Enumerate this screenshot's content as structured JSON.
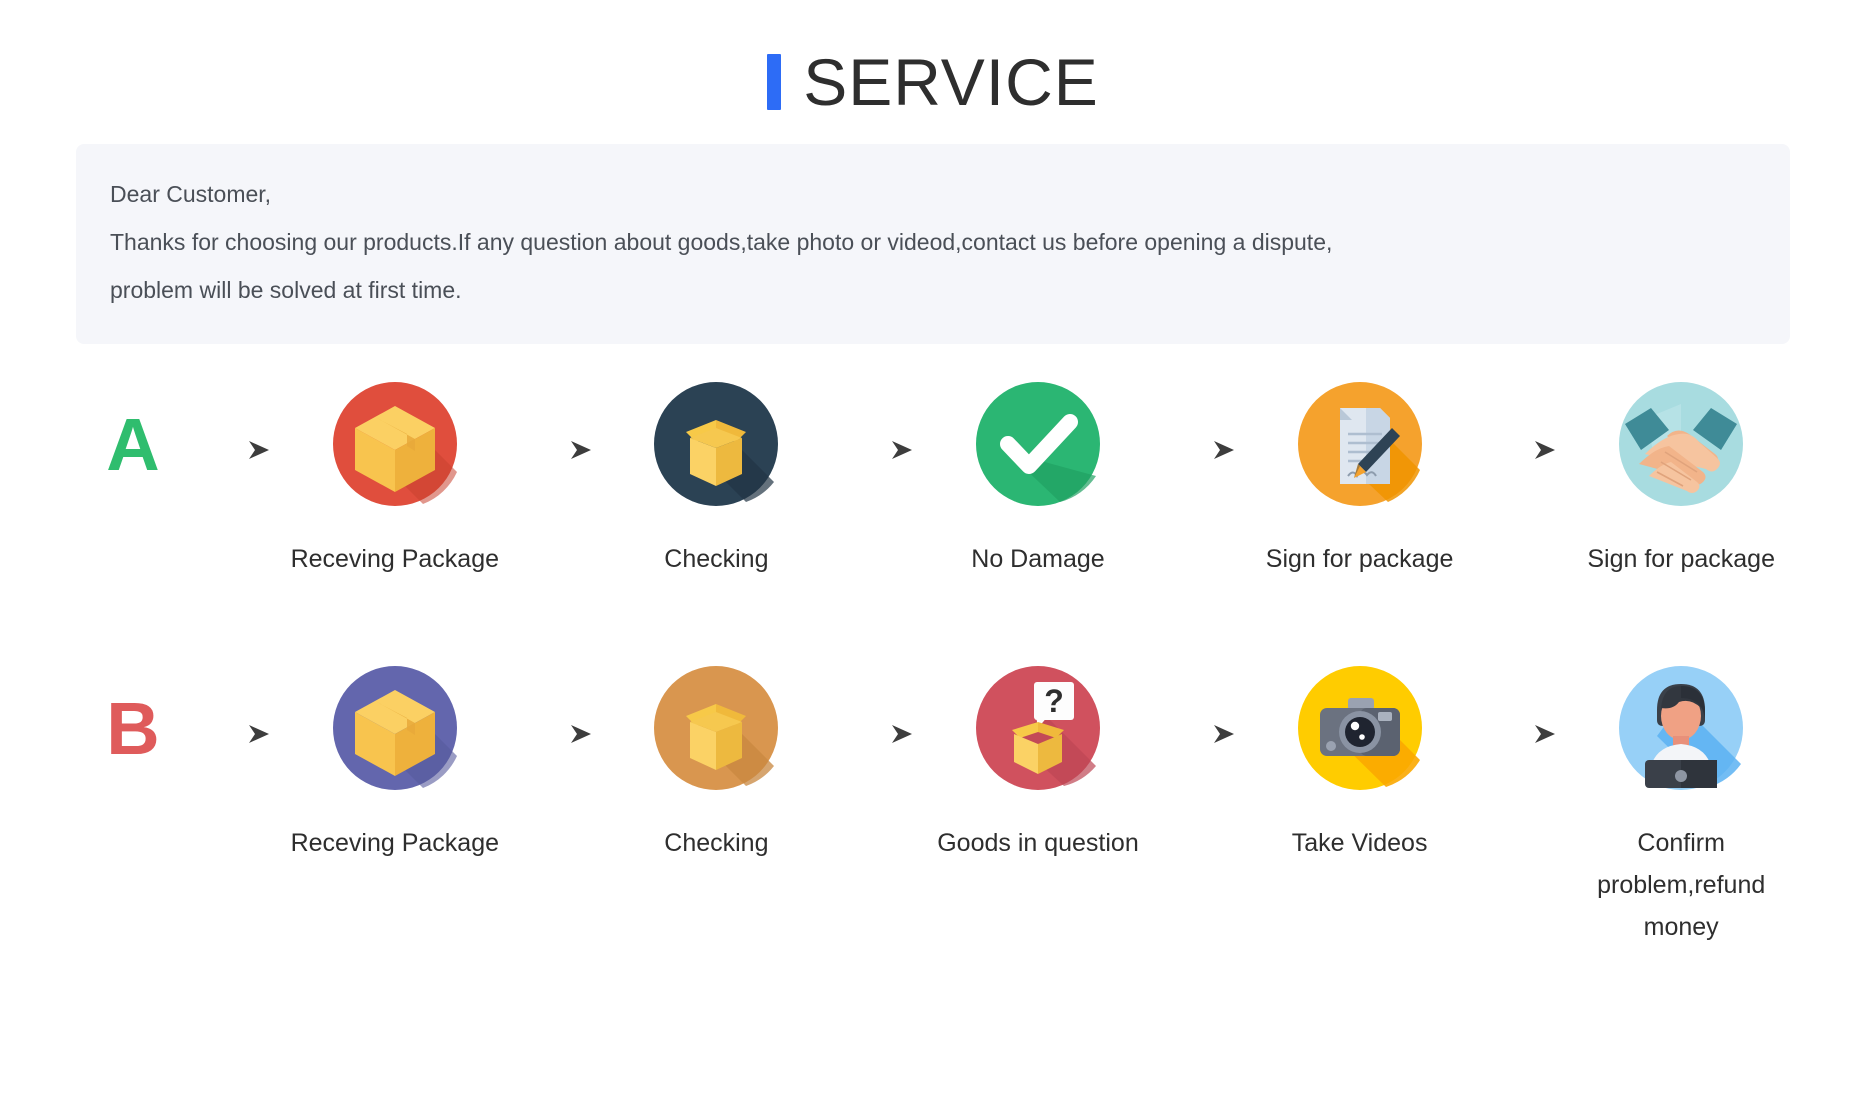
{
  "header": {
    "accent_color": "#2d6cf6",
    "title": "SERVICE"
  },
  "notice": {
    "line1": "Dear Customer,",
    "line2": "Thanks for choosing our products.If any question about goods,take photo or videod,contact us before opening a dispute,",
    "line3": "problem will be solved at first time.",
    "background_color": "#f5f6fa"
  },
  "flows": [
    {
      "badge": "A",
      "badge_color": "#2fbd6e",
      "steps": [
        {
          "label": "Receving Package",
          "icon": "closed-box-icon",
          "circle_color": "#e04e3d"
        },
        {
          "label": "Checking",
          "icon": "open-box-icon",
          "circle_color": "#2b4254"
        },
        {
          "label": "No Damage",
          "icon": "check-mark-icon",
          "circle_color": "#2bb673"
        },
        {
          "label": "Sign for package",
          "icon": "document-pen-icon",
          "circle_color": "#f5a22d"
        },
        {
          "label": "Sign for package",
          "icon": "handshake-icon",
          "circle_color": "#a8dce0"
        }
      ]
    },
    {
      "badge": "B",
      "badge_color": "#df5b5b",
      "steps": [
        {
          "label": "Receving Package",
          "icon": "closed-box-icon",
          "circle_color": "#6366ad"
        },
        {
          "label": "Checking",
          "icon": "open-box-icon",
          "circle_color": "#d9964f"
        },
        {
          "label": "Goods in question",
          "icon": "question-box-icon",
          "circle_color": "#d0515e"
        },
        {
          "label": "Take Videos",
          "icon": "camera-icon",
          "circle_color": "#ffcc00"
        },
        {
          "label": "Confirm problem,refund money",
          "icon": "support-person-icon",
          "circle_color": "#97d0f7"
        }
      ]
    }
  ],
  "arrow": {
    "name": "right-arrow-icon",
    "color": "#4a4a4a"
  }
}
